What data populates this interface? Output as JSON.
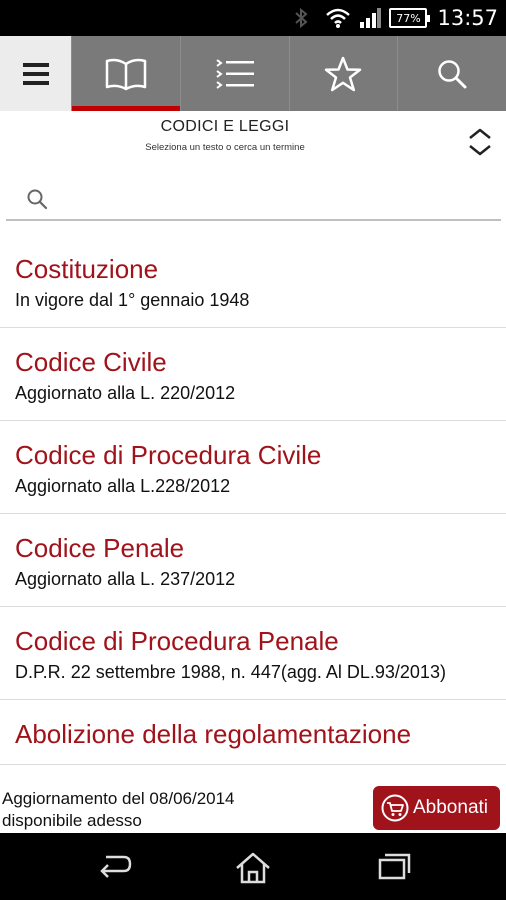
{
  "status_bar": {
    "battery": "77%",
    "time": "13:57"
  },
  "toolbar": {
    "tabs": [
      {
        "icon": "menu-icon"
      },
      {
        "icon": "book-icon",
        "active": true
      },
      {
        "icon": "list-icon"
      },
      {
        "icon": "star-icon"
      },
      {
        "icon": "search-icon"
      }
    ]
  },
  "header": {
    "title": "CODICI E LEGGI",
    "subtitle": "Seleziona un testo o cerca un termine"
  },
  "search": {
    "value": "",
    "placeholder": ""
  },
  "items": [
    {
      "title": "Costituzione",
      "subtitle": "In vigore dal 1° gennaio 1948"
    },
    {
      "title": "Codice Civile",
      "subtitle": "Aggiornato alla  L. 220/2012"
    },
    {
      "title": "Codice di Procedura Civile",
      "subtitle": "Aggiornato alla L.228/2012"
    },
    {
      "title": "Codice Penale",
      "subtitle": "Aggiornato alla L. 237/2012"
    },
    {
      "title": "Codice di Procedura Penale",
      "subtitle": "D.P.R. 22 settembre 1988, n. 447(agg. Al DL.93/2013)"
    },
    {
      "title": "Abolizione della regolamentazione",
      "subtitle": ""
    }
  ],
  "update_bar": {
    "line1": "Aggiornamento del 08/06/2014",
    "line2": "disponibile adesso",
    "button_label": "Abbonati"
  },
  "colors": {
    "accent": "#a1131b",
    "toolbar": "#7a7a7a",
    "active_tab_indicator": "#c00000"
  }
}
